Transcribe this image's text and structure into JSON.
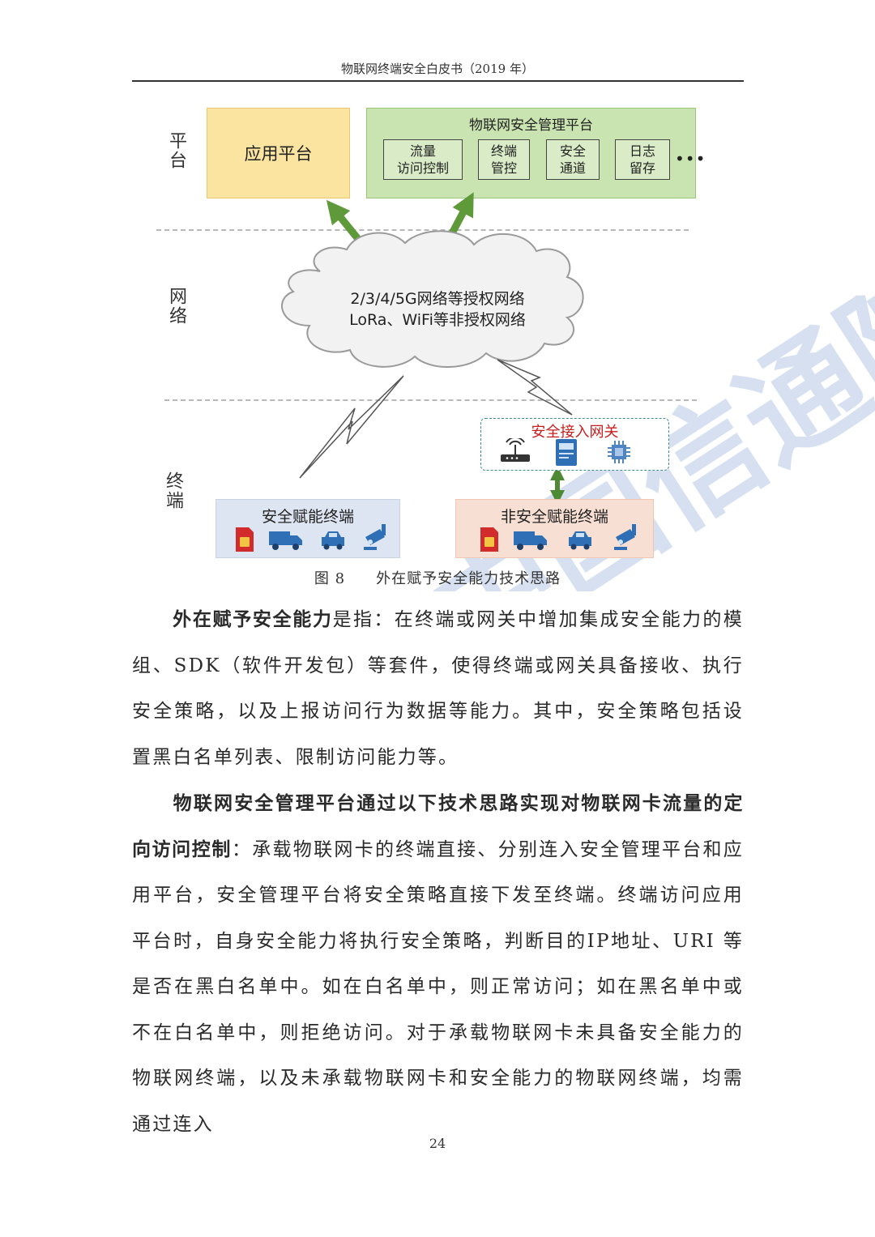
{
  "header": {
    "title": "物联网终端安全白皮书（2019 年）"
  },
  "figure": {
    "side_labels": {
      "platform": "平台",
      "network": "网络",
      "terminal": "终端"
    },
    "app_platform": "应用平台",
    "mgmt_platform": {
      "title": "物联网安全管理平台",
      "modules": [
        {
          "line1": "流量",
          "line2": "访问控制"
        },
        {
          "line1": "终端",
          "line2": "管控"
        },
        {
          "line1": "安全",
          "line2": "通道"
        },
        {
          "line1": "日志",
          "line2": "留存"
        }
      ],
      "ellipsis": "•••"
    },
    "cloud": {
      "line1": "2/3/4/5G网络等授权网络",
      "line2": "LoRa、WiFi等非授权网络"
    },
    "gateway": {
      "title": "安全接入网关"
    },
    "terminals": {
      "left_title": "安全赋能终端",
      "right_title": "非安全赋能终端"
    },
    "caption": {
      "number": "图 8",
      "text": "外在赋予安全能力技术思路"
    },
    "colors": {
      "app_fill": "#fbe3a0",
      "mgmt_fill": "#c9e4b0",
      "arrow": "#5e9a3a",
      "gateway_title": "#c81e1e",
      "term_left_fill": "#dde5f2",
      "term_right_fill": "#f7dfd3"
    }
  },
  "paragraphs": [
    {
      "bold": "外在赋予安全能力",
      "text": "是指：在终端或网关中增加集成安全能力的模组、SDK（软件开发包）等套件，使得终端或网关具备接收、执行安全策略，以及上报访问行为数据等能力。其中，安全策略包括设置黑白名单列表、限制访问能力等。"
    },
    {
      "bold": "物联网安全管理平台通过以下技术思路实现对物联网卡流量的定向访问控制",
      "text": "：承载物联网卡的终端直接、分别连入安全管理平台和应用平台，安全管理平台将安全策略直接下发至终端。终端访问应用平台时，自身安全能力将执行安全策略，判断目的IP地址、URI 等是否在黑白名单中。如在白名单中，则正常访问；如在黑名单中或不在白名单中，则拒绝访问。对于承载物联网卡未具备安全能力的物联网终端，以及未承载物联网卡和安全能力的物联网终端，均需通过连入"
    }
  ],
  "page_number": "24",
  "watermark": {
    "text": "CAICT中国信通院"
  }
}
